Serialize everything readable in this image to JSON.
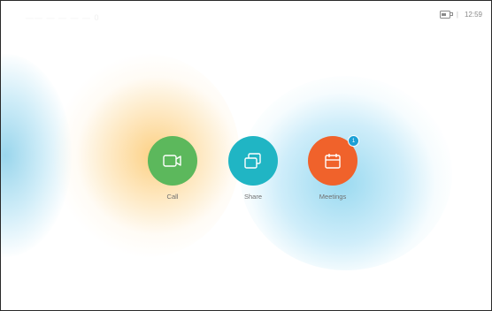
{
  "topbar": {
    "blurred_title": "—— — — — — 0",
    "separator": "|",
    "time": "12:59"
  },
  "actions": {
    "call": {
      "label": "Call",
      "color": "#5cb85c",
      "icon": "video-camera-icon"
    },
    "share": {
      "label": "Share",
      "color": "#20b5c4",
      "icon": "share-screen-icon"
    },
    "meetings": {
      "label": "Meetings",
      "color": "#f0622b",
      "icon": "calendar-icon",
      "badge": "1"
    }
  }
}
